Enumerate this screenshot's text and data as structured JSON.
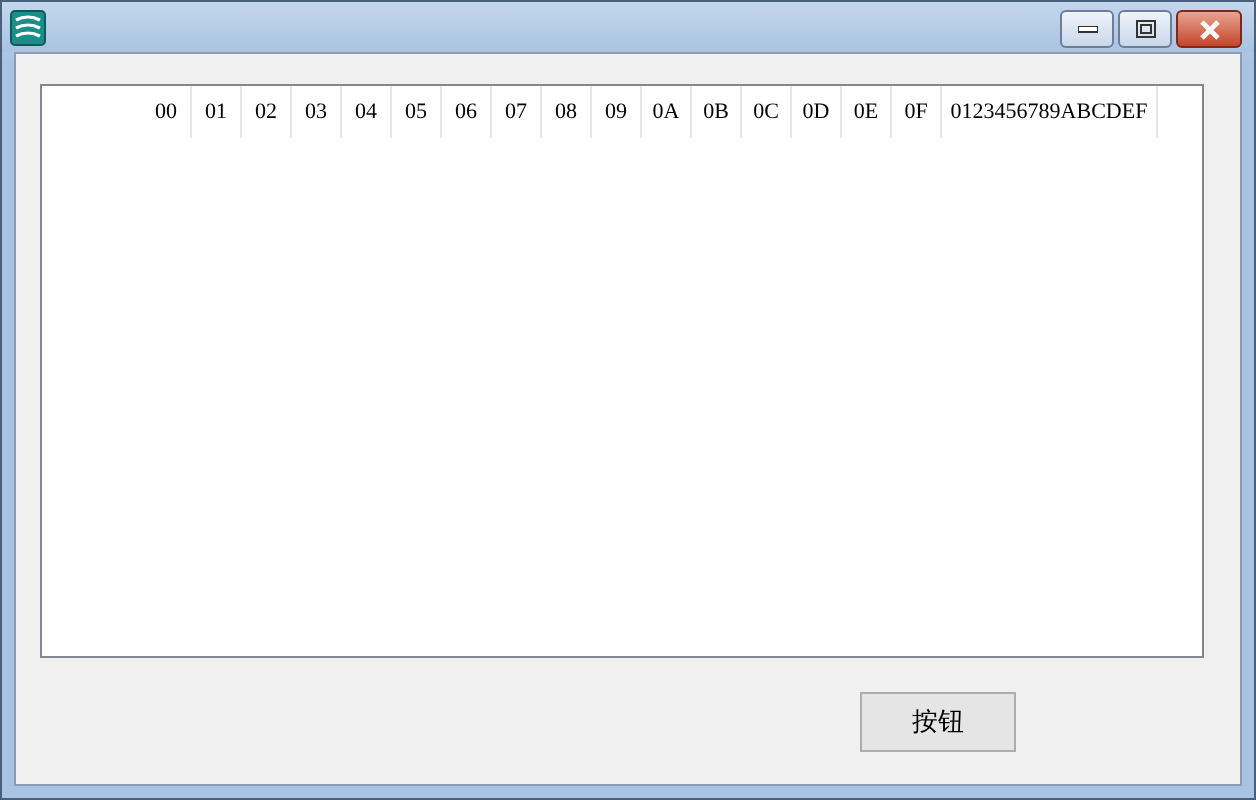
{
  "table": {
    "columns": [
      {
        "label": "00"
      },
      {
        "label": "01"
      },
      {
        "label": "02"
      },
      {
        "label": "03"
      },
      {
        "label": "04"
      },
      {
        "label": "05"
      },
      {
        "label": "06"
      },
      {
        "label": "07"
      },
      {
        "label": "08"
      },
      {
        "label": "09"
      },
      {
        "label": "0A"
      },
      {
        "label": "0B"
      },
      {
        "label": "0C"
      },
      {
        "label": "0D"
      },
      {
        "label": "0E"
      },
      {
        "label": "0F"
      },
      {
        "label": "0123456789ABCDEF"
      }
    ]
  },
  "buttons": [
    {
      "label": "按钮"
    }
  ]
}
